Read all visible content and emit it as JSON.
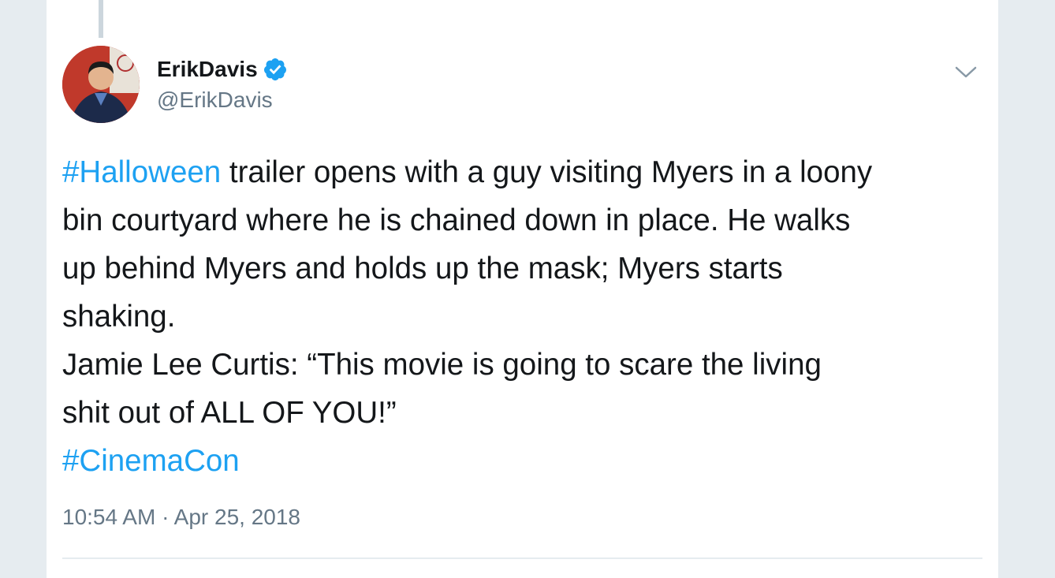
{
  "tweet": {
    "author": {
      "display_name": "ErikDavis",
      "handle": "@ErikDavis",
      "verified": true
    },
    "text_lines": [
      {
        "hashtag": "#Halloween",
        "text": " trailer opens with a guy visiting Myers in a loony"
      },
      {
        "text": "bin courtyard where he is chained down in place. He walks"
      },
      {
        "text": "up behind Myers and holds up the mask; Myers starts"
      },
      {
        "text": "shaking."
      },
      {
        "text": "Jamie Lee Curtis: “This movie is going to scare the living"
      },
      {
        "text": "shit out of ALL OF YOU!”"
      },
      {
        "hashtag": "#CinemaCon"
      }
    ],
    "timestamp": "10:54 AM · Apr 25, 2018"
  },
  "colors": {
    "link": "#1da1f2",
    "text": "#14171a",
    "secondary": "#657786",
    "background": "#e6ecf0"
  },
  "icons": {
    "verified": "verified-badge-icon",
    "menu": "chevron-down-icon"
  }
}
